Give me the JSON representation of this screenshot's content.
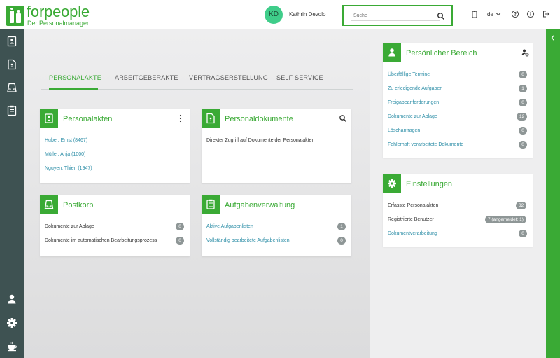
{
  "header": {
    "brand": "forpeople",
    "tagline": "Der Personalmanager.",
    "user_initials": "KD",
    "user_name": "Kathrin Devolo",
    "search_placeholder": "Suche",
    "language": "de",
    "icons": [
      "clipboard-icon",
      "chevron-down-icon",
      "help-icon",
      "info-icon",
      "logout-icon"
    ]
  },
  "sidebar": {
    "top_icons": [
      "personnel-file-icon",
      "document-icon",
      "inbox-icon",
      "task-list-icon"
    ],
    "bottom_icons": [
      "user-icon",
      "gear-icon",
      "coffee-icon"
    ]
  },
  "tabs": [
    {
      "label": "PERSONALAKTE",
      "active": true
    },
    {
      "label": "ARBEITGEBERAKTE",
      "active": false
    },
    {
      "label": "VERTRAGSERSTELLUNG",
      "active": false
    },
    {
      "label": "SELF SERVICE",
      "active": false
    }
  ],
  "cards": {
    "personalakten": {
      "title": "Personalakten",
      "items": [
        "Huber, Ernst (8467)",
        "Müller, Anja (1000)",
        "Nguyen, Thien (1947)"
      ]
    },
    "personaldokumente": {
      "title": "Personaldokumente",
      "text": "Direkter Zugriff auf Dokumente der Personalakten"
    },
    "postkorb": {
      "title": "Postkorb",
      "items": [
        {
          "label": "Dokumente zur Ablage",
          "count": "0"
        },
        {
          "label": "Dokumente im automatischen Bearbeitungsprozess",
          "count": "0"
        }
      ]
    },
    "aufgabenverwaltung": {
      "title": "Aufgabenverwaltung",
      "items": [
        {
          "label": "Aktive Aufgabenlisten",
          "count": "1"
        },
        {
          "label": "Vollständig bearbeitete Aufgabenlisten",
          "count": "0"
        }
      ]
    }
  },
  "personal_area": {
    "title": "Persönlicher Bereich",
    "items": [
      {
        "label": "Überfällige Termine",
        "count": "0"
      },
      {
        "label": "Zu erledigende Aufgaben",
        "count": "1"
      },
      {
        "label": "Freigabeanforderungen",
        "count": "0"
      },
      {
        "label": "Dokumente zur Ablage",
        "count": "12"
      },
      {
        "label": "Löschanfragen",
        "count": "0"
      },
      {
        "label": "Fehlerhaft verarbeitete Dokumente",
        "count": "0"
      }
    ]
  },
  "settings": {
    "title": "Einstellungen",
    "items": [
      {
        "label": "Erfasste Personalakten",
        "count": "32"
      },
      {
        "label": "Registrierte Benutzer",
        "count": "7 (angemeldet: 1)"
      },
      {
        "label": "Dokumentverarbeitung",
        "count": "0"
      }
    ]
  },
  "colors": {
    "brand_green": "#3aaa35",
    "sidebar": "#3e5252",
    "link": "#2d8ea7",
    "badge": "#8e9696",
    "avatar": "#3fcd8a"
  }
}
